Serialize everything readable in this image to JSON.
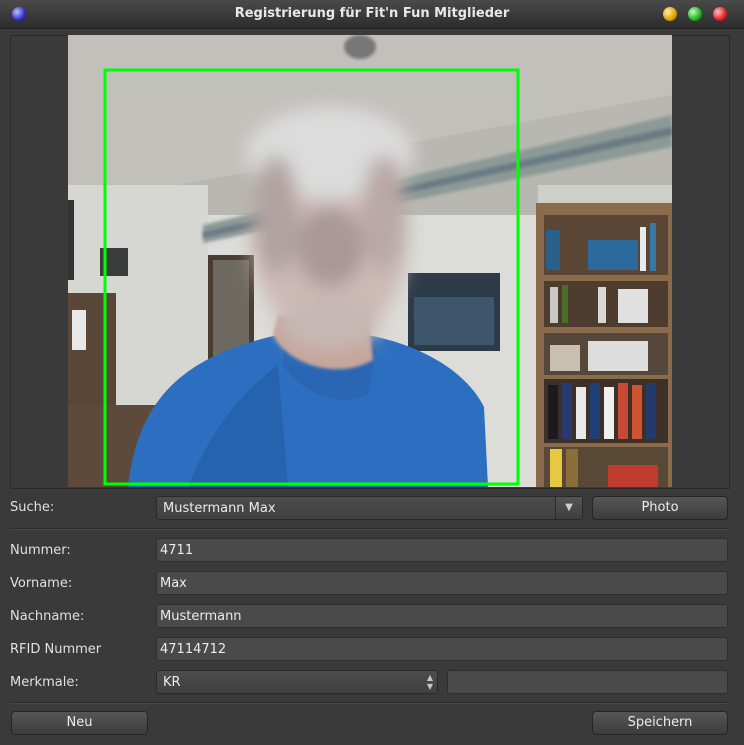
{
  "window": {
    "title": "Registrierung für Fit'n Fun Mitglieder"
  },
  "colors": {
    "face_box": "#00ff00",
    "background": "#3a3a3a"
  },
  "search": {
    "label": "Suche:",
    "value": "Mustermann Max",
    "photo_button": "Photo"
  },
  "form": {
    "nummer_label": "Nummer:",
    "nummer_value": "4711",
    "vorname_label": "Vorname:",
    "vorname_value": "Max",
    "nachname_label": "Nachname:",
    "nachname_value": "Mustermann",
    "rfid_label": "RFID Nummer",
    "rfid_value": "47114712",
    "merkmale_label": "Merkmale:",
    "merkmale_value": "KR",
    "merkmale_extra": ""
  },
  "buttons": {
    "new": "Neu",
    "save": "Speichern"
  }
}
